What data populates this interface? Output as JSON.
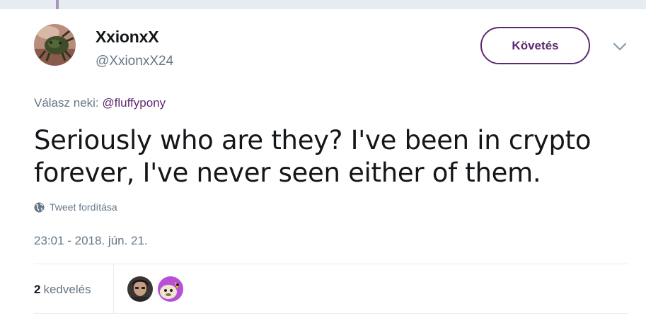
{
  "tweet": {
    "author": {
      "name": "XxionxX",
      "handle": "@XxionxX24"
    },
    "follow_label": "Követés",
    "reply_prefix": "Válasz neki:",
    "reply_mention": "@fluffypony",
    "text": "Seriously who are they? I've been in crypto forever, I've never seen either of them.",
    "translate_label": "Tweet fordítása",
    "timestamp": "23:01 - 2018. jún. 21.",
    "likes": {
      "count": "2",
      "label": "kedvelés"
    }
  },
  "colors": {
    "accent": "#5d2a72",
    "secondary_text": "#657786",
    "primary_text": "#14171a",
    "divider": "#e6ecf0"
  },
  "icons": [
    "globe-icon",
    "chevron-down-icon"
  ]
}
